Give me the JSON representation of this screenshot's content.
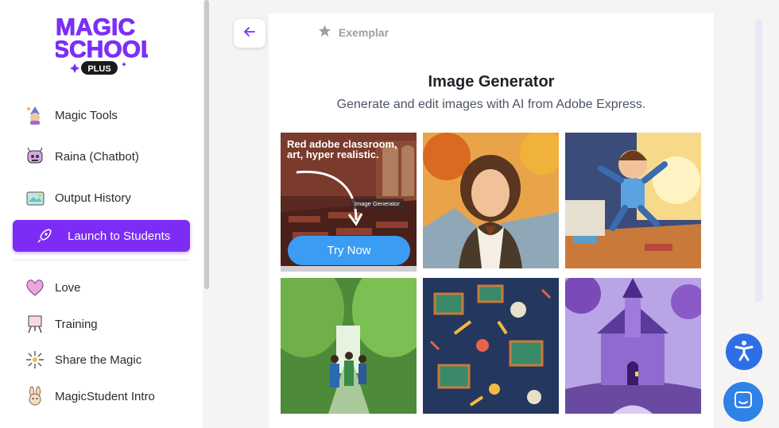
{
  "logo": {
    "line1": "MAGIC",
    "line2": "SCHOOL",
    "badge": "PLUS"
  },
  "sidebar": {
    "items": [
      {
        "label": "Magic Tools",
        "icon": "magic-tools-icon"
      },
      {
        "label": "Raina (Chatbot)",
        "icon": "chatbot-icon"
      },
      {
        "label": "Output History",
        "icon": "history-icon"
      },
      {
        "label": "Launch to Students",
        "icon": "rocket-icon"
      },
      {
        "label": "Love",
        "icon": "heart-icon"
      },
      {
        "label": "Training",
        "icon": "easel-icon"
      },
      {
        "label": "Share the Magic",
        "icon": "sparkle-icon"
      },
      {
        "label": "MagicStudent Intro",
        "icon": "bunny-icon"
      }
    ]
  },
  "main": {
    "exemplar": "Exemplar",
    "title": "Image Generator",
    "subtitle": "Generate and edit images with AI from Adobe Express.",
    "promo": {
      "text": "Red adobe classroom, art, hyper realistic.",
      "tag": "Image Generator",
      "button": "Try Now"
    },
    "gallery": [
      "woman-portrait",
      "boy-jumping",
      "students-path",
      "school-pattern",
      "purple-castle"
    ]
  },
  "colors": {
    "accent": "#7c2cf4",
    "try_now": "#3b9cf3",
    "accessibility": "#2f6fe6"
  }
}
